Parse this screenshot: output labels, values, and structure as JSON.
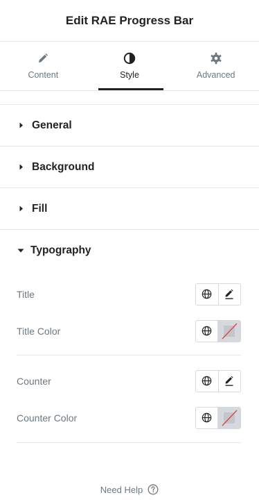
{
  "header": {
    "title": "Edit RAE Progress Bar"
  },
  "tabs": [
    {
      "label": "Content",
      "icon": "pencil-icon",
      "active": false
    },
    {
      "label": "Style",
      "icon": "contrast-icon",
      "active": true
    },
    {
      "label": "Advanced",
      "icon": "gear-icon",
      "active": false
    }
  ],
  "sections": {
    "general": "General",
    "background": "Background",
    "fill": "Fill",
    "typography": "Typography"
  },
  "controls": {
    "title": "Title",
    "title_color": "Title Color",
    "counter": "Counter",
    "counter_color": "Counter Color"
  },
  "footer": {
    "help": "Need Help"
  },
  "colors": {
    "text": "#1f2124",
    "muted": "#6d7882",
    "border": "#d5d8dc",
    "swatch_slash": "#e04040"
  }
}
